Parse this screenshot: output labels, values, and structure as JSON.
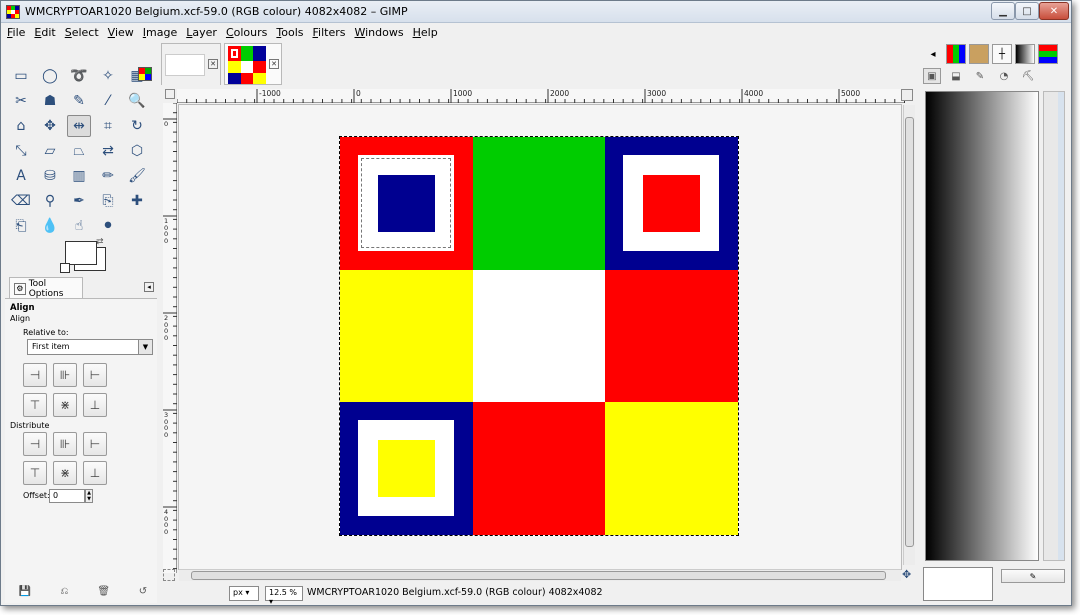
{
  "window": {
    "title": "WMCRYPTOAR1020 Belgium.xcf-59.0 (RGB colour) 4082x4082 – GIMP",
    "minimize": "▁",
    "maximize": "□",
    "close": "✕"
  },
  "menubar": [
    {
      "key": "F",
      "rest": "ile"
    },
    {
      "key": "E",
      "rest": "dit"
    },
    {
      "key": "S",
      "rest": "elect"
    },
    {
      "key": "V",
      "rest": "iew"
    },
    {
      "key": "I",
      "rest": "mage"
    },
    {
      "key": "L",
      "rest": "ayer"
    },
    {
      "key": "C",
      "rest": "olours"
    },
    {
      "key": "T",
      "rest": "ools"
    },
    {
      "key": "F",
      "rest": "ilters"
    },
    {
      "key": "W",
      "rest": "indows"
    },
    {
      "key": "H",
      "rest": "elp"
    }
  ],
  "tools": [
    {
      "name": "rect-select-icon",
      "glyph": "▭"
    },
    {
      "name": "ellipse-select-icon",
      "glyph": "◯"
    },
    {
      "name": "free-select-icon",
      "glyph": "➰"
    },
    {
      "name": "fuzzy-select-icon",
      "glyph": "✧"
    },
    {
      "name": "select-by-color-icon",
      "glyph": "▦"
    },
    {
      "name": "scissors-select-icon",
      "glyph": "✂"
    },
    {
      "name": "foreground-select-icon",
      "glyph": "☗"
    },
    {
      "name": "paths-icon",
      "glyph": "✎"
    },
    {
      "name": "color-picker-icon",
      "glyph": "⁄"
    },
    {
      "name": "zoom-icon",
      "glyph": "🔍"
    },
    {
      "name": "measure-icon",
      "glyph": "⌂"
    },
    {
      "name": "move-icon",
      "glyph": "✥"
    },
    {
      "name": "align-icon",
      "glyph": "⇹"
    },
    {
      "name": "crop-icon",
      "glyph": "⌗"
    },
    {
      "name": "rotate-icon",
      "glyph": "↻"
    },
    {
      "name": "scale-icon",
      "glyph": "⤡"
    },
    {
      "name": "shear-icon",
      "glyph": "▱"
    },
    {
      "name": "perspective-icon",
      "glyph": "⏢"
    },
    {
      "name": "flip-icon",
      "glyph": "⇄"
    },
    {
      "name": "cage-icon",
      "glyph": "⬡"
    },
    {
      "name": "text-icon",
      "glyph": "A"
    },
    {
      "name": "bucket-fill-icon",
      "glyph": "⛁"
    },
    {
      "name": "blend-icon",
      "glyph": "▥"
    },
    {
      "name": "pencil-icon",
      "glyph": "✏"
    },
    {
      "name": "paintbrush-icon",
      "glyph": "🖌"
    },
    {
      "name": "eraser-icon",
      "glyph": "⌫"
    },
    {
      "name": "airbrush-icon",
      "glyph": "⚲"
    },
    {
      "name": "ink-icon",
      "glyph": "✒"
    },
    {
      "name": "clone-icon",
      "glyph": "⎘"
    },
    {
      "name": "heal-icon",
      "glyph": "✚"
    },
    {
      "name": "perspective-clone-icon",
      "glyph": "⎗"
    },
    {
      "name": "blur-icon",
      "glyph": "💧"
    },
    {
      "name": "smudge-icon",
      "glyph": "☝"
    },
    {
      "name": "dodge-burn-icon",
      "glyph": "⚫"
    }
  ],
  "active_tool_index": 12,
  "tool_options": {
    "tab_label": "Tool Options",
    "title": "Align",
    "subtitle": "Align",
    "relative_to_label": "Relative to:",
    "relative_to_value": "First item",
    "distribute_label": "Distribute",
    "offset_label": "Offset:",
    "offset_value": "0"
  },
  "rulers": {
    "top": [
      "-1000",
      "0",
      "1000",
      "2000",
      "3000",
      "4000",
      "5000"
    ],
    "left": [
      "0",
      "1000",
      "2000",
      "3000",
      "4000"
    ]
  },
  "image_colors": {
    "red": "#ff0000",
    "green": "#00cc00",
    "navy": "#000090",
    "yellow": "#ffff00",
    "white": "#ffffff"
  },
  "status": {
    "unit": "px",
    "zoom": "12.5 %",
    "text": "WMCRYPTOAR1020 Belgium.xcf-59.0 (RGB colour) 4082x4082"
  }
}
